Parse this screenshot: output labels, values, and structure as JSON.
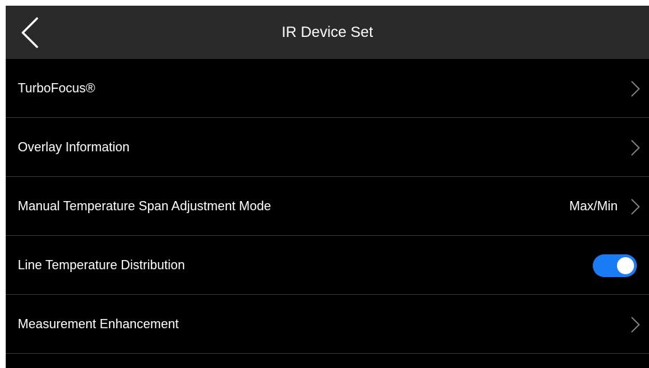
{
  "header": {
    "title": "IR Device Set",
    "back_icon": "chevron-left-icon"
  },
  "settings": {
    "items": [
      {
        "label": "TurboFocus®",
        "control": "chevron"
      },
      {
        "label": "Overlay Information",
        "control": "chevron"
      },
      {
        "label": "Manual Temperature Span Adjustment Mode",
        "value": "Max/Min",
        "control": "chevron"
      },
      {
        "label": "Line Temperature Distribution",
        "control": "toggle",
        "toggle_on": true
      },
      {
        "label": "Measurement Enhancement",
        "control": "chevron"
      }
    ]
  },
  "colors": {
    "background": "#000000",
    "header": "#2a2a2a",
    "divider": "#333333",
    "accent": "#1a7cf5",
    "text": "#ffffff",
    "chevron": "#8a8a8a"
  }
}
